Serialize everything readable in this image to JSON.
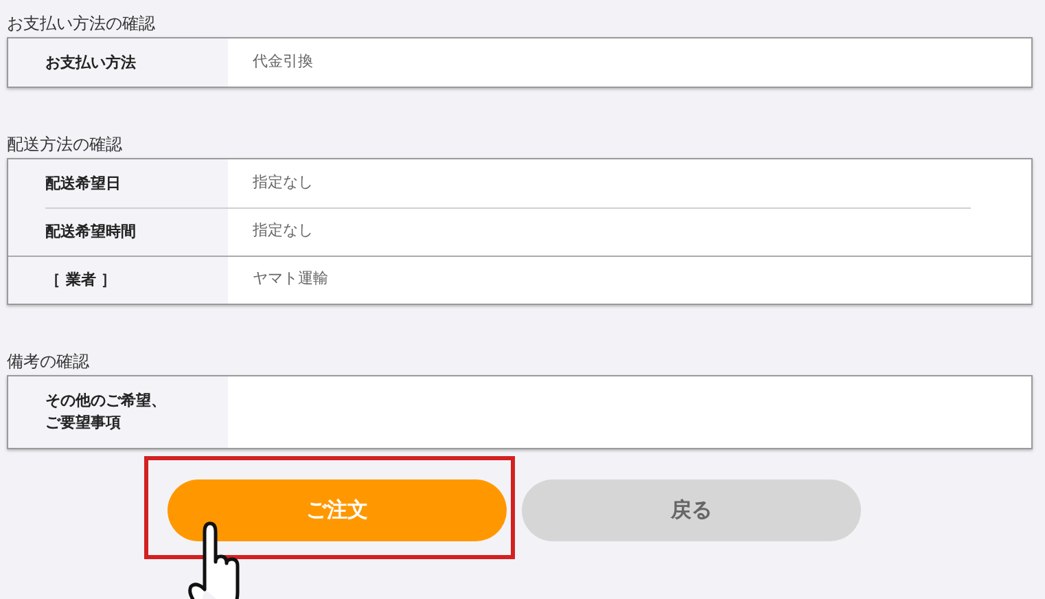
{
  "sections": [
    {
      "title": "お支払い方法の確認",
      "rows": [
        {
          "label": "お支払い方法",
          "value": "代金引換"
        }
      ]
    },
    {
      "title": "配送方法の確認",
      "rows": [
        {
          "label": "配送希望日",
          "value": "指定なし"
        },
        {
          "label": "配送希望時間",
          "value": "指定なし"
        },
        {
          "label": "［ 業者 ］",
          "value": "ヤマト運輸"
        }
      ]
    },
    {
      "title": "備考の確認",
      "rows": [
        {
          "label": [
            "その他のご希望、",
            "ご要望事項"
          ]
        }
      ]
    }
  ],
  "buttons": [
    {
      "label": "ご注文",
      "kind": "primary",
      "highlighted": true
    },
    {
      "label": "戻る",
      "kind": "secondary",
      "highlighted": false
    }
  ]
}
